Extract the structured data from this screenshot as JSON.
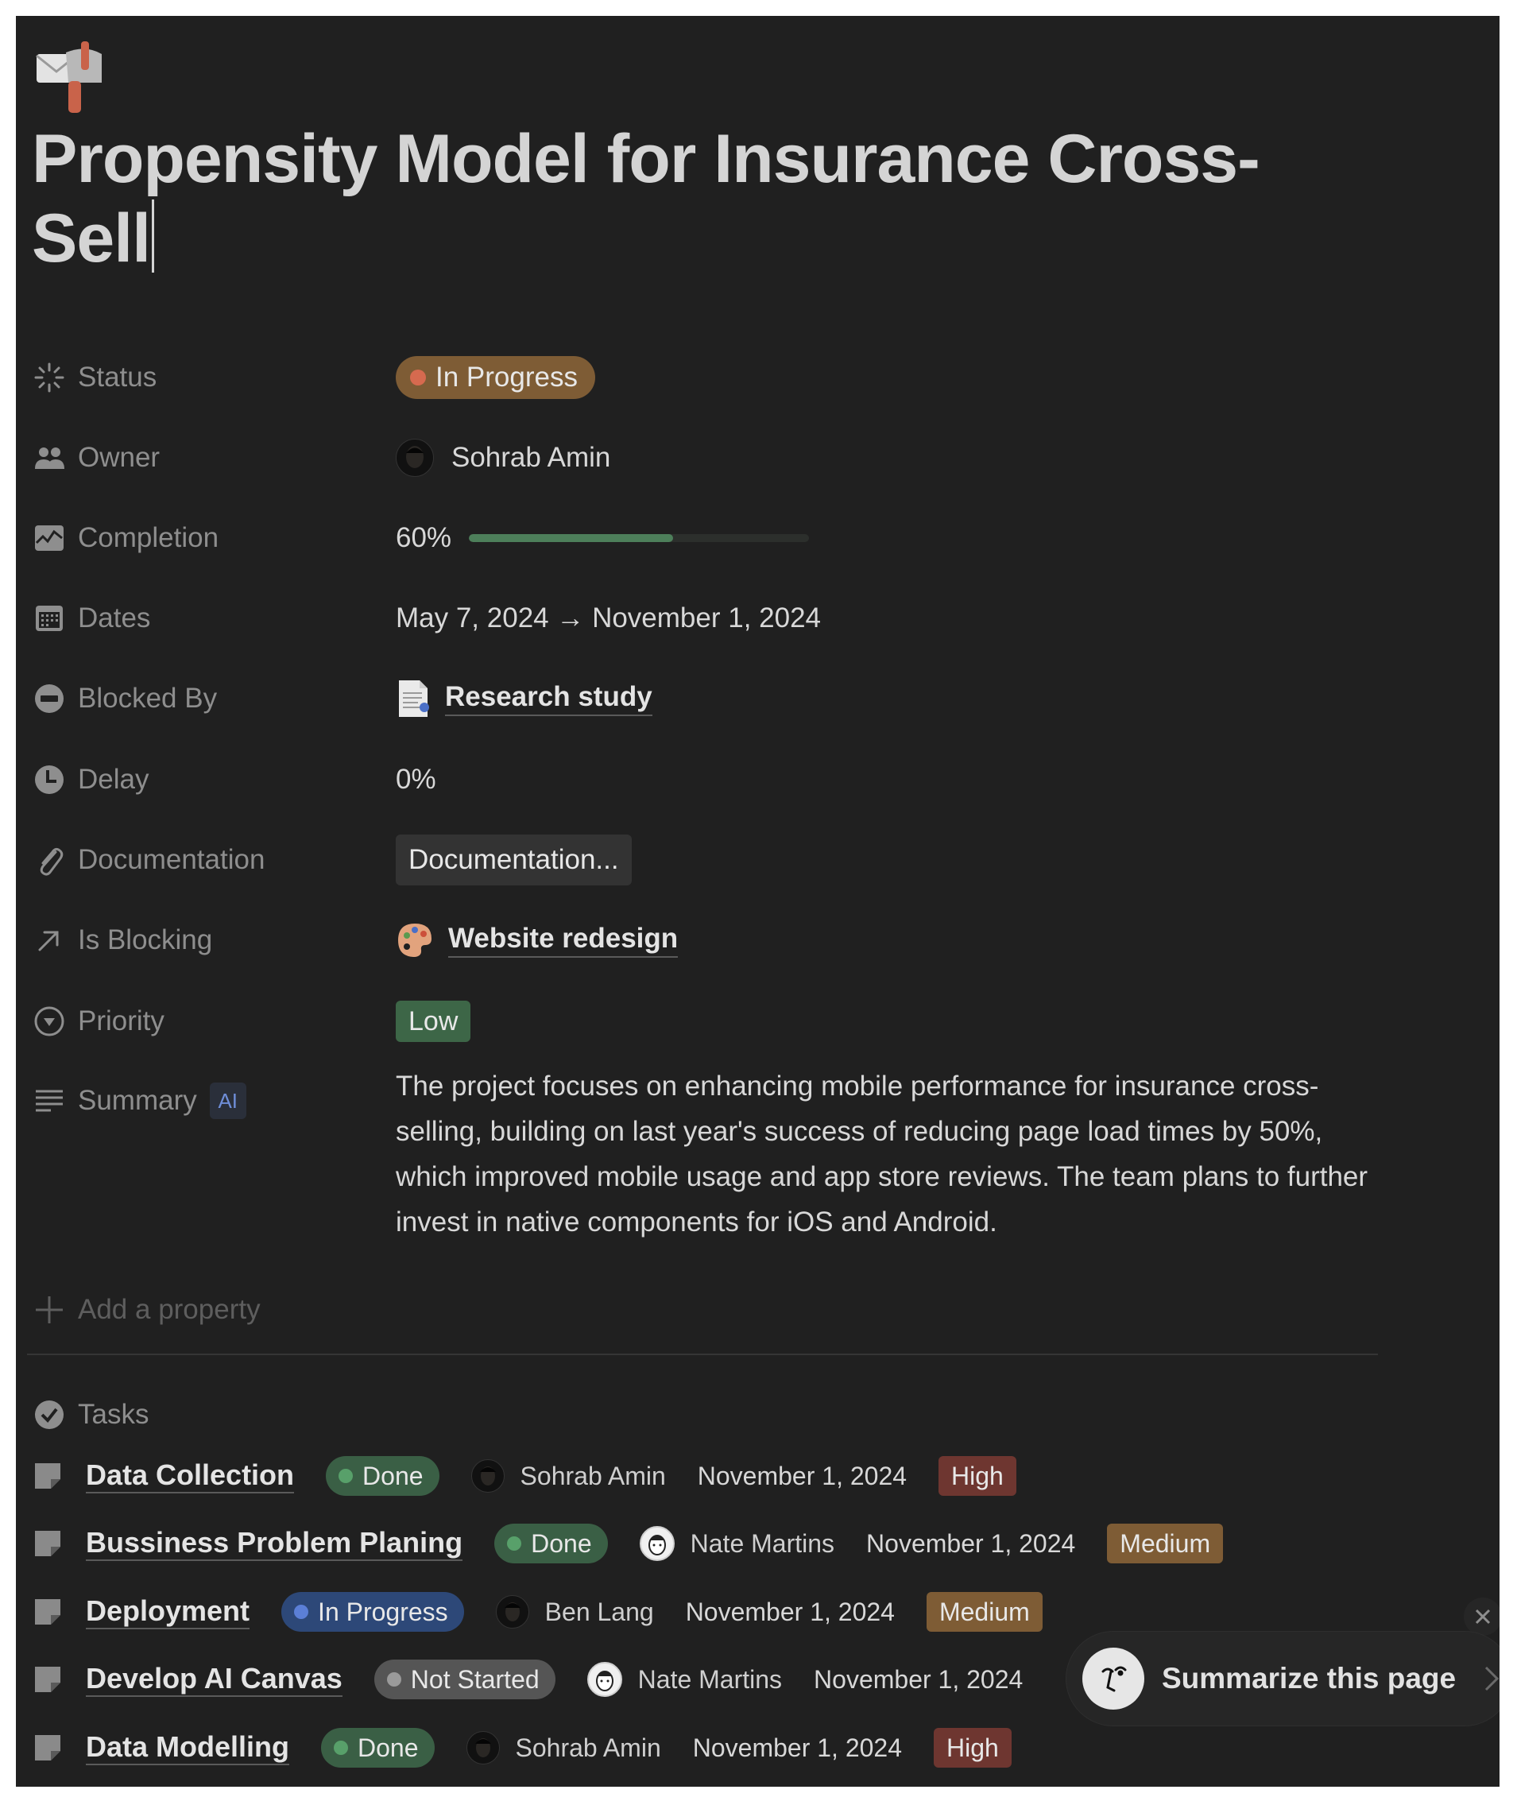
{
  "page": {
    "icon": "mailbox-icon",
    "title": "Propensity Model for Insurance Cross-Sell"
  },
  "properties": {
    "status": {
      "label": "Status",
      "icon": "status-icon",
      "value": "In Progress",
      "color": "#7e5c35",
      "dot_color": "#d66a4f"
    },
    "owner": {
      "label": "Owner",
      "icon": "people-icon",
      "value": "Sohrab Amin"
    },
    "completion": {
      "label": "Completion",
      "icon": "chart-icon",
      "value_text": "60%",
      "value": 0.6,
      "color": "#4d7f5a"
    },
    "dates": {
      "label": "Dates",
      "icon": "calendar-icon",
      "value": "May 7, 2024 → November 1, 2024"
    },
    "blocked_by": {
      "label": "Blocked By",
      "icon": "blocked-icon",
      "value": "Research study",
      "value_icon": "document-icon"
    },
    "delay": {
      "label": "Delay",
      "icon": "clock-icon",
      "value": "0%"
    },
    "documentation": {
      "label": "Documentation",
      "icon": "paperclip-icon",
      "value": "Documentation..."
    },
    "is_blocking": {
      "label": "Is Blocking",
      "icon": "arrow-up-right-icon",
      "value": "Website redesign",
      "value_icon": "palette-icon"
    },
    "priority": {
      "label": "Priority",
      "icon": "priority-icon",
      "value": "Low",
      "color": "#3d6647"
    },
    "summary": {
      "label": "Summary",
      "icon": "text-lines-icon",
      "badge": "AI",
      "value": "The project focuses on enhancing mobile performance for insurance cross-selling, building on last year's success of reducing page load times by 50%, which improved mobile usage and app store reviews. The team plans to further invest in native components for iOS and Android."
    }
  },
  "add_property_label": "Add a property",
  "tasks": {
    "label": "Tasks",
    "items": [
      {
        "title": "Data Collection",
        "status": "Done",
        "status_color": "#3a5f45",
        "dot_color": "#58a06a",
        "owner": "Sohrab Amin",
        "avatar": "dark",
        "date": "November 1, 2024",
        "priority": "High",
        "priority_color": "#6e3630"
      },
      {
        "title": "Bussiness Problem Planing",
        "status": "Done",
        "status_color": "#3a5f45",
        "dot_color": "#58a06a",
        "owner": "Nate Martins",
        "avatar": "light",
        "date": "November 1, 2024",
        "priority": "Medium",
        "priority_color": "#7e5c35"
      },
      {
        "title": "Deployment",
        "status": "In Progress",
        "status_color": "#2d4878",
        "dot_color": "#5b7fd6",
        "owner": "Ben Lang",
        "avatar": "dark",
        "date": "November 1, 2024",
        "priority": "Medium",
        "priority_color": "#7e5c35"
      },
      {
        "title": "Develop AI Canvas",
        "status": "Not Started",
        "status_color": "#555555",
        "dot_color": "#9a9a9a",
        "owner": "Nate Martins",
        "avatar": "light",
        "date": "November 1, 2024",
        "priority": "",
        "priority_color": "#7e5c35"
      },
      {
        "title": "Data Modelling",
        "status": "Done",
        "status_color": "#3a5f45",
        "dot_color": "#58a06a",
        "owner": "Sohrab Amin",
        "avatar": "dark",
        "date": "November 1, 2024",
        "priority": "High",
        "priority_color": "#6e3630"
      }
    ]
  },
  "ai_popup": {
    "label": "Summarize this page",
    "close_icon": "close-icon",
    "chevron_icon": "chevron-right-icon"
  }
}
